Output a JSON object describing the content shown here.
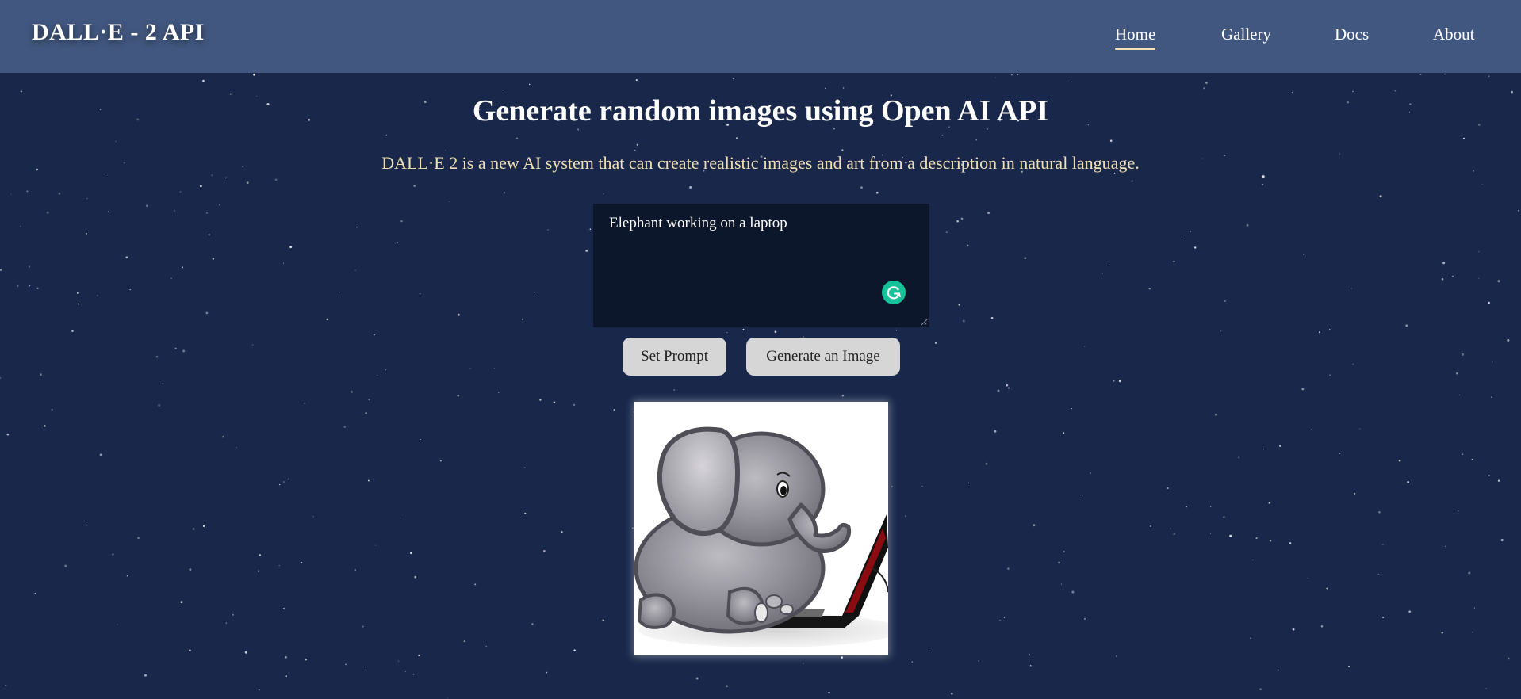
{
  "app": {
    "brand": "DALL·E - 2 API"
  },
  "nav": {
    "items": [
      {
        "label": "Home",
        "active": true
      },
      {
        "label": "Gallery",
        "active": false
      },
      {
        "label": "Docs",
        "active": false
      },
      {
        "label": "About",
        "active": false
      }
    ]
  },
  "main": {
    "title": "Generate random images using Open AI API",
    "description": "DALL·E 2 is a new AI system that can create realistic images and art from a description in natural language."
  },
  "prompt": {
    "value": "Elephant working on a laptop"
  },
  "buttons": {
    "set_prompt": "Set Prompt",
    "generate": "Generate an Image"
  },
  "result": {
    "image_icon": "elephant-on-laptop-image"
  },
  "colors": {
    "background": "#18274a",
    "header": "#42577f",
    "accent": "#f0dfb4",
    "textarea": "#0d172b",
    "button": "#d6d6d6",
    "grammarly": "#15c39a"
  }
}
